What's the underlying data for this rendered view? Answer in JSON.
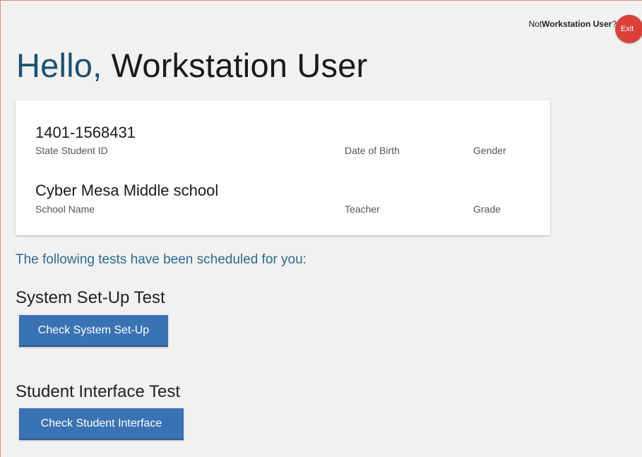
{
  "header": {
    "not_prefix": "Not ",
    "user_name": "Workstation User",
    "not_suffix": "?",
    "exit_label": "Exit"
  },
  "greeting": {
    "hello": "Hello,",
    "name": "Workstation User"
  },
  "student_card": {
    "student_id": "1401-1568431",
    "student_id_label": "State Student ID",
    "dob_label": "Date of Birth",
    "gender_label": "Gender",
    "school_name": "Cyber Mesa Middle school",
    "school_name_label": "School Name",
    "teacher_label": "Teacher",
    "grade_label": "Grade"
  },
  "scheduled_text": "The following tests have been scheduled for you:",
  "tests": {
    "system_title": "System Set-Up Test",
    "system_button": "Check System Set-Up",
    "student_title": "Student Interface Test",
    "student_button": "Check Student Interface"
  },
  "colors": {
    "accent_blue": "#1b5170",
    "button_blue": "#3a73b3",
    "exit_red": "#d9413a"
  }
}
